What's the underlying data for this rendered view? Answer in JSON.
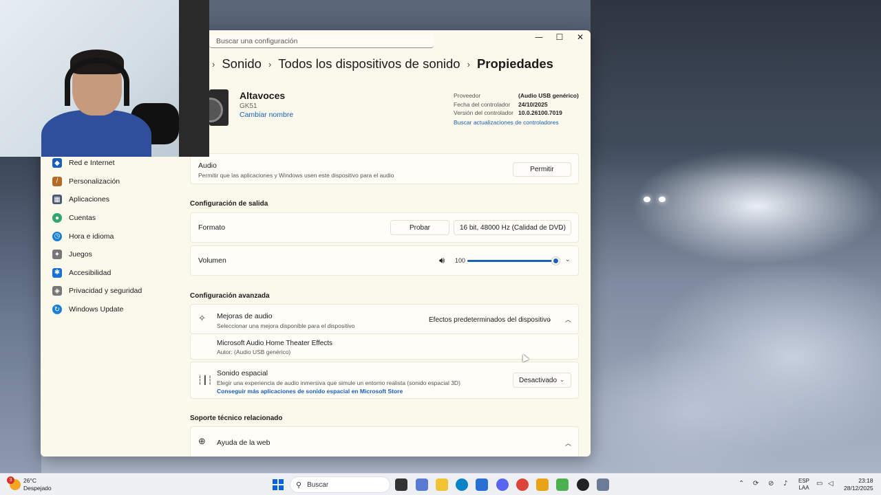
{
  "window": {
    "search_placeholder": "Buscar una configuración",
    "minimize": "—",
    "maximize": "☐",
    "close": "✕"
  },
  "breadcrumb": {
    "items": [
      "Sonido",
      "Todos los dispositivos de sonido",
      "Propiedades"
    ],
    "separator": "›"
  },
  "device": {
    "name": "Altavoces",
    "model": "GK51",
    "rename_link": "Cambiar nombre"
  },
  "properties": {
    "provider_label": "Proveedor",
    "provider_value": "(Audio USB genérico)",
    "driver_date_label": "Fecha del controlador",
    "driver_date_value": "24/10/2025",
    "driver_version_label": "Versión del controlador",
    "driver_version_value": "10.0.26100.7019",
    "update_link": "Buscar actualizaciones de controladores"
  },
  "sidebar": {
    "items": [
      {
        "label": "Red e Internet",
        "icon": "wifi-icon",
        "color": "#1a5fb4"
      },
      {
        "label": "Personalización",
        "icon": "brush-icon",
        "color": "#b66a2a"
      },
      {
        "label": "Aplicaciones",
        "icon": "apps-icon",
        "color": "#4a5a70"
      },
      {
        "label": "Cuentas",
        "icon": "account-icon",
        "color": "#2fa66a"
      },
      {
        "label": "Hora e idioma",
        "icon": "globe-clock-icon",
        "color": "#1a7fd4"
      },
      {
        "label": "Juegos",
        "icon": "controller-icon",
        "color": "#777777"
      },
      {
        "label": "Accesibilidad",
        "icon": "accessibility-icon",
        "color": "#1a6fd4"
      },
      {
        "label": "Privacidad y seguridad",
        "icon": "shield-icon",
        "color": "#777777"
      },
      {
        "label": "Windows Update",
        "icon": "update-icon",
        "color": "#1a7fd4"
      }
    ]
  },
  "audio_card": {
    "title": "Audio",
    "subtitle": "Permitir que las aplicaciones y Windows usen este dispositivo para el audio",
    "button": "Permitir"
  },
  "output_section": {
    "label": "Configuración de salida",
    "format_label": "Formato",
    "test_button": "Probar",
    "format_value": "16 bit, 48000 Hz (Calidad de DVD)",
    "volume_label": "Volumen",
    "volume_value": "100",
    "volume_level": 1.0
  },
  "advanced_section": {
    "label": "Configuración avanzada",
    "enhancements_title": "Mejoras de audio",
    "enhancements_sub": "Seleccionar una mejora disponible para el dispositivo",
    "enhancements_value": "Efectos predeterminados del dispositivo",
    "effect_name": "Microsoft Audio Home Theater Effects",
    "effect_author": "Autor: (Audio USB genérico)",
    "spatial_title": "Sonido espacial",
    "spatial_sub": "Elegir una experiencia de audio inmersiva que simule un entorno realista (sonido espacial 3D)",
    "spatial_link": "Conseguir más aplicaciones de sonido espacial en Microsoft Store",
    "spatial_value": "Desactivado"
  },
  "support_section": {
    "label": "Soporte técnico relacionado",
    "web_help": "Ayuda de la web"
  },
  "taskbar": {
    "weather_temp": "26°C",
    "weather_desc": "Despejado",
    "weather_badge": "3",
    "search_label": "Buscar",
    "lang_top": "ESP",
    "lang_bottom": "LAA",
    "time": "23:18",
    "date": "28/12/2025",
    "accent": "#0a64d8"
  }
}
